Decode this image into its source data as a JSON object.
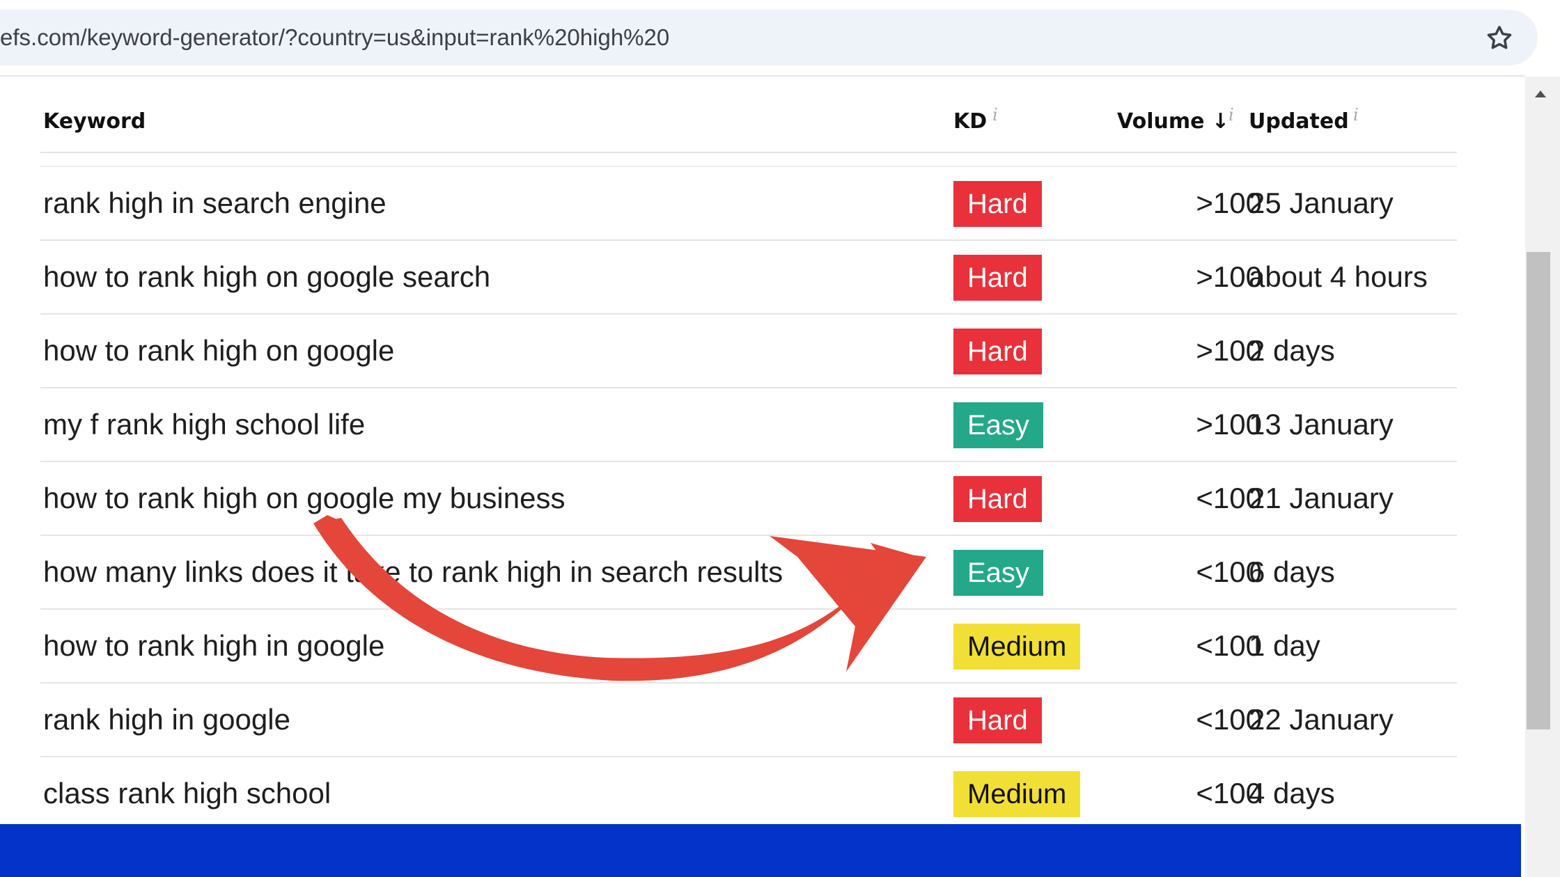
{
  "browser": {
    "url": "efs.com/keyword-generator/?country=us&input=rank%20high%20",
    "bookmark_icon": "star-icon"
  },
  "table": {
    "headers": {
      "keyword": "Keyword",
      "kd": "KD",
      "volume": "Volume",
      "updated": "Updated",
      "info": "i",
      "sort_arrow": "↓"
    },
    "rows": [
      {
        "keyword": "rank high in search engine",
        "kd": "Hard",
        "volume": ">100",
        "updated": "25 January"
      },
      {
        "keyword": "how to rank high on google search",
        "kd": "Hard",
        "volume": ">100",
        "updated": "about 4 hours"
      },
      {
        "keyword": "how to rank high on google",
        "kd": "Hard",
        "volume": ">100",
        "updated": "2 days"
      },
      {
        "keyword": "my f rank high school life",
        "kd": "Easy",
        "volume": ">100",
        "updated": "13 January"
      },
      {
        "keyword": "how to rank high on google my business",
        "kd": "Hard",
        "volume": "<100",
        "updated": "21 January"
      },
      {
        "keyword": "how many links does it take to rank high in search results",
        "kd": "Easy",
        "volume": "<100",
        "updated": "6 days"
      },
      {
        "keyword": "how to rank high in google",
        "kd": "Medium",
        "volume": "<100",
        "updated": "1 day"
      },
      {
        "keyword": "rank high in google",
        "kd": "Hard",
        "volume": "<100",
        "updated": "22 January"
      },
      {
        "keyword": "class rank high school",
        "kd": "Medium",
        "volume": "<100",
        "updated": "4 days"
      }
    ]
  },
  "colors": {
    "hard": "#e8313a",
    "easy": "#24a88a",
    "medium": "#f2df35",
    "bottom_bar": "#0333c8",
    "annotation_arrow": "#e4463a"
  },
  "icons": [
    "star-icon",
    "info-icon",
    "sort-down-icon",
    "scroll-up-icon",
    "curved-arrow-annotation"
  ]
}
